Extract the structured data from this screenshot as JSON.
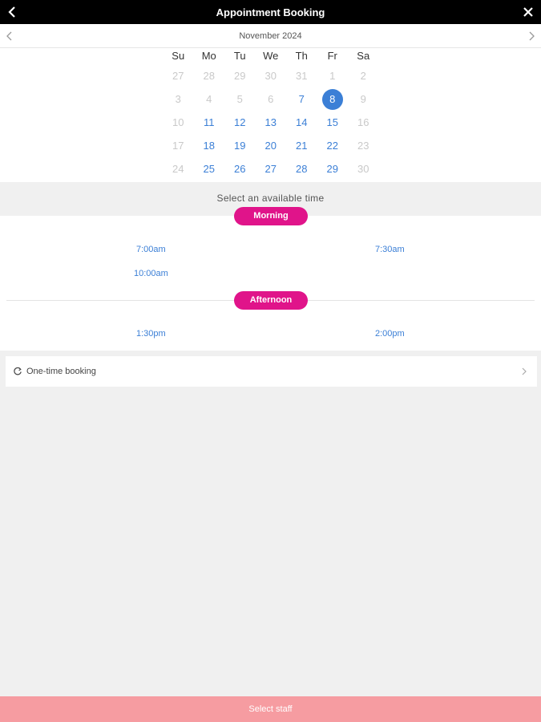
{
  "header": {
    "title": "Appointment Booking"
  },
  "calendar": {
    "month_label": "November 2024",
    "weekdays": [
      "Su",
      "Mo",
      "Tu",
      "We",
      "Th",
      "Fr",
      "Sa"
    ],
    "weeks": [
      [
        {
          "d": "27",
          "s": "disabled"
        },
        {
          "d": "28",
          "s": "disabled"
        },
        {
          "d": "29",
          "s": "disabled"
        },
        {
          "d": "30",
          "s": "disabled"
        },
        {
          "d": "31",
          "s": "disabled"
        },
        {
          "d": "1",
          "s": "disabled"
        },
        {
          "d": "2",
          "s": "disabled"
        }
      ],
      [
        {
          "d": "3",
          "s": "disabled"
        },
        {
          "d": "4",
          "s": "disabled"
        },
        {
          "d": "5",
          "s": "disabled"
        },
        {
          "d": "6",
          "s": "disabled"
        },
        {
          "d": "7",
          "s": "available"
        },
        {
          "d": "8",
          "s": "selected"
        },
        {
          "d": "9",
          "s": "disabled"
        }
      ],
      [
        {
          "d": "10",
          "s": "disabled"
        },
        {
          "d": "11",
          "s": "available"
        },
        {
          "d": "12",
          "s": "available"
        },
        {
          "d": "13",
          "s": "available"
        },
        {
          "d": "14",
          "s": "available"
        },
        {
          "d": "15",
          "s": "available"
        },
        {
          "d": "16",
          "s": "disabled"
        }
      ],
      [
        {
          "d": "17",
          "s": "disabled"
        },
        {
          "d": "18",
          "s": "available"
        },
        {
          "d": "19",
          "s": "available"
        },
        {
          "d": "20",
          "s": "available"
        },
        {
          "d": "21",
          "s": "available"
        },
        {
          "d": "22",
          "s": "available"
        },
        {
          "d": "23",
          "s": "disabled"
        }
      ],
      [
        {
          "d": "24",
          "s": "disabled"
        },
        {
          "d": "25",
          "s": "available"
        },
        {
          "d": "26",
          "s": "available"
        },
        {
          "d": "27",
          "s": "available"
        },
        {
          "d": "28",
          "s": "available"
        },
        {
          "d": "29",
          "s": "available"
        },
        {
          "d": "30",
          "s": "disabled"
        }
      ]
    ]
  },
  "times": {
    "prompt": "Select an available time",
    "morning_label": "Morning",
    "afternoon_label": "Afternoon",
    "morning_slots": [
      "7:00am",
      "7:30am",
      "10:00am"
    ],
    "afternoon_slots": [
      "1:30pm",
      "2:00pm"
    ]
  },
  "booking": {
    "label": "One-time booking"
  },
  "footer": {
    "button_label": "Select staff"
  },
  "colors": {
    "accent_blue": "#3b7fd6",
    "pill_magenta": "#e0148a",
    "footer_pink": "#f69ca1",
    "topbar_black": "#000000"
  },
  "icons": {
    "back": "chevron-left-icon",
    "close": "close-icon",
    "prev_month": "chevron-left-icon",
    "next_month": "chevron-right-icon",
    "booking": "refresh-icon",
    "booking_chevron": "chevron-right-icon"
  }
}
